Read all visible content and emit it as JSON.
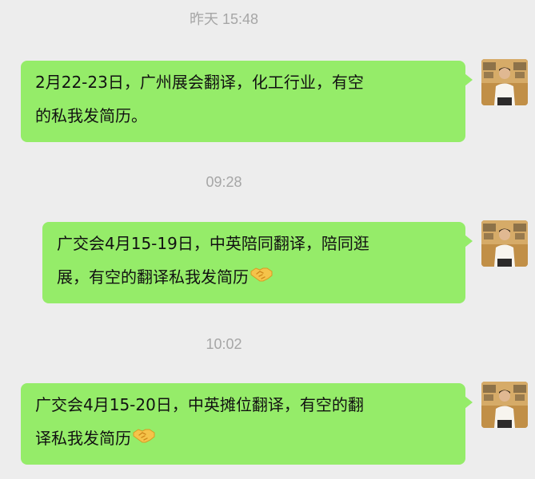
{
  "chat": {
    "messages": [
      {
        "timestamp": "昨天 15:48",
        "lines": [
          "2月22-23日，广州展会翻译，化工行业，有空",
          "的私我发简历。"
        ],
        "emoji": ""
      },
      {
        "timestamp": "09:28",
        "lines": [
          "广交会4月15-19日，中英陪同翻译，陪同逛",
          "展，有空的翻译私我发简历"
        ],
        "emoji": "handshake"
      },
      {
        "timestamp": "10:02",
        "lines": [
          "广交会4月15-20日，中英摊位翻译，有空的翻",
          "译私我发简历"
        ],
        "emoji": "handshake"
      }
    ]
  },
  "colors": {
    "background": "#ededed",
    "bubble": "#95ec69",
    "timestamp": "#a6a6a6",
    "text": "#111111"
  },
  "icons": {
    "avatar": "profile-photo-avatar",
    "emoji": "handshake-emoji-icon"
  }
}
